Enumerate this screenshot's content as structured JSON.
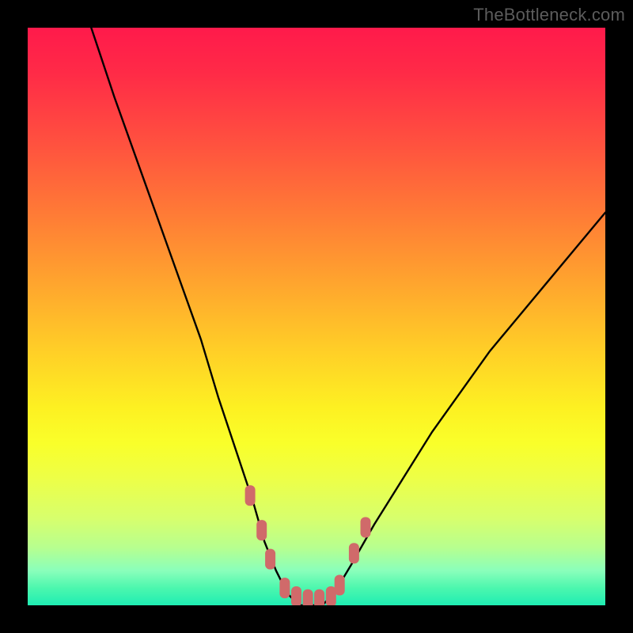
{
  "attribution": "TheBottleneck.com",
  "chart_data": {
    "type": "line",
    "title": "",
    "xlabel": "",
    "ylabel": "",
    "xlim": [
      0,
      100
    ],
    "ylim": [
      0,
      100
    ],
    "series": [
      {
        "name": "bottleneck-curve",
        "x": [
          11,
          15,
          20,
          25,
          30,
          33,
          36,
          39,
          41,
          43,
          45,
          47,
          49,
          51,
          53,
          56,
          60,
          65,
          70,
          75,
          80,
          85,
          90,
          95,
          100
        ],
        "values": [
          100,
          88,
          74,
          60,
          46,
          36,
          27,
          18,
          11,
          6,
          2,
          0,
          0,
          0,
          2,
          7,
          14,
          22,
          30,
          37,
          44,
          50,
          56,
          62,
          68
        ]
      }
    ],
    "markers": {
      "name": "highlight-points",
      "color": "#d06a6a",
      "x": [
        38.5,
        40.5,
        42.0,
        44.5,
        46.5,
        48.5,
        50.5,
        52.5,
        54.0,
        56.5,
        58.5
      ],
      "values": [
        19.0,
        13.0,
        8.0,
        3.0,
        1.5,
        1.0,
        1.0,
        1.5,
        3.5,
        9.0,
        13.5
      ]
    },
    "background": {
      "type": "vertical-gradient",
      "stops": [
        {
          "pos": 0,
          "color": "#ff1a4b"
        },
        {
          "pos": 20,
          "color": "#ff513f"
        },
        {
          "pos": 44,
          "color": "#ffa42e"
        },
        {
          "pos": 66,
          "color": "#fdf122"
        },
        {
          "pos": 85,
          "color": "#d7ff6d"
        },
        {
          "pos": 100,
          "color": "#1fedb3"
        }
      ]
    }
  }
}
